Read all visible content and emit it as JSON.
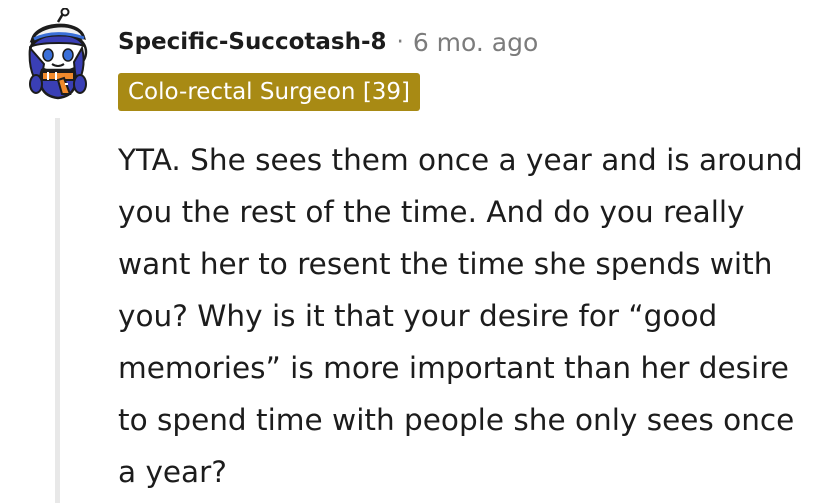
{
  "comment": {
    "username": "Specific-Succotash-8",
    "separator": "·",
    "timestamp": "6 mo. ago",
    "flair": "Colo-rectal Surgeon [39]",
    "flair_color": "#a88a14",
    "body": "YTA. She sees them once a year and is around you the rest of the time. And do you really want her to resent the time she spends with you? Why is it that your desire for “good memories” is more important than her desire to spend time with people she only sees once a year?",
    "avatar_icon": "snoo-avatar-icon"
  }
}
